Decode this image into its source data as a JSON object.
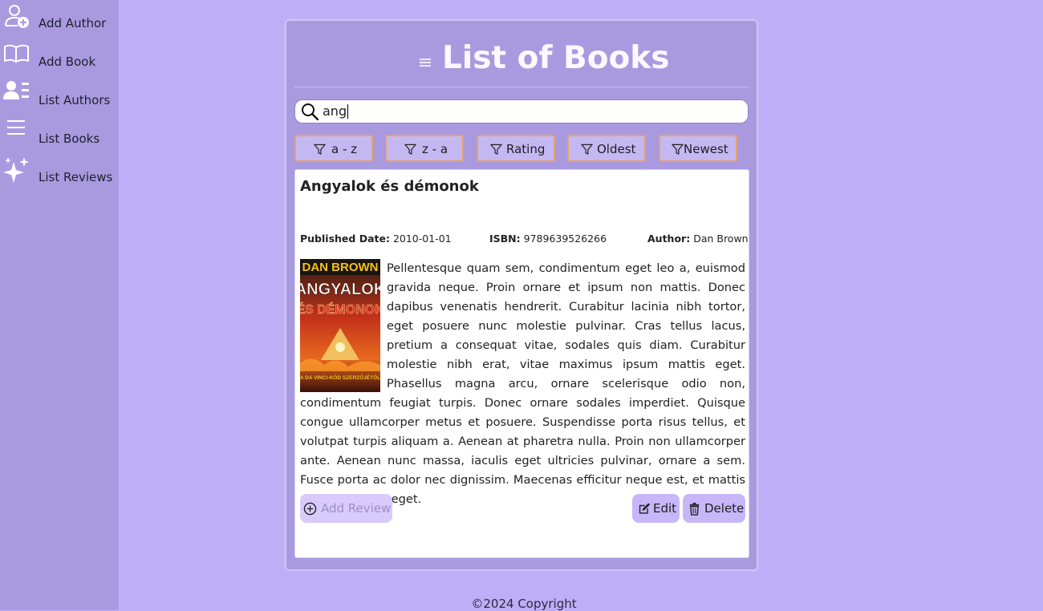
{
  "sidebar": {
    "items": [
      {
        "label": "Add Author",
        "icon": "add-author-icon"
      },
      {
        "label": "Add Book",
        "icon": "book-open-icon"
      },
      {
        "label": "List Authors",
        "icon": "list-authors-icon"
      },
      {
        "label": "List Books",
        "icon": "list-icon"
      },
      {
        "label": "List Reviews",
        "icon": "sparkles-icon"
      }
    ]
  },
  "main": {
    "title": "List of Books",
    "search": {
      "value": "ang"
    },
    "filters": [
      {
        "label": "a - z",
        "icon": "filter-icon"
      },
      {
        "label": "z - a",
        "icon": "filter-icon"
      },
      {
        "label": "Rating",
        "icon": "filter-icon"
      },
      {
        "label": "Oldest",
        "icon": "filter-icon"
      },
      {
        "label": "Newest",
        "icon": "filter-icon"
      }
    ]
  },
  "book": {
    "title": "Angyalok és démonok",
    "published_label": "Published Date:",
    "published_value": "2010-01-01",
    "isbn_label": "ISBN:",
    "isbn_value": "9789639526266",
    "author_label": "Author:",
    "author_value": "Dan Brown",
    "cover": {
      "author_text": "DAN BROWN",
      "title_line1": "ANGYALOK",
      "title_line2": "ÉS DÉMONOK",
      "tagline": "A DA VINCI-KÓD SZERZŐJÉTŐL"
    },
    "description": "Pellentesque quam sem, condimentum eget leo a, euismod gravida neque. Proin ornare et ipsum non mattis. Donec dapibus venenatis hendrerit. Curabitur lacinia nibh tortor, eget posuere nunc molestie pulvinar. Cras tellus lacus, pretium a consequat vitae, sodales quis diam. Curabitur molestie nibh erat, vitae maximus ipsum mattis eget. Phasellus magna arcu, ornare scelerisque odio non, condimentum feugiat turpis. Donec ornare sodales imperdiet. Quisque congue ullamcorper metus et posuere. Suspendisse porta risus tellus, et volutpat turpis aliquam a. Aenean at pharetra nulla. Proin non ullamcorper ante. Aenean nunc massa, iaculis eget ultricies pulvinar, ornare a sem. Fusce porta ac dolor nec dignissim. Maecenas efficitur neque est, et mattis augue eleifend eget.",
    "actions": {
      "add_review": "Add Review",
      "edit": "Edit",
      "delete": "Delete"
    }
  },
  "footer": {
    "text": "©2024 Copyright"
  },
  "colors": {
    "page_bg": "#bcaef7",
    "sidebar_bg": "#a99ae0",
    "card_bg": "#a99ae0",
    "button_bg": "#c7b7f8",
    "filter_border": "#e5a06a"
  }
}
